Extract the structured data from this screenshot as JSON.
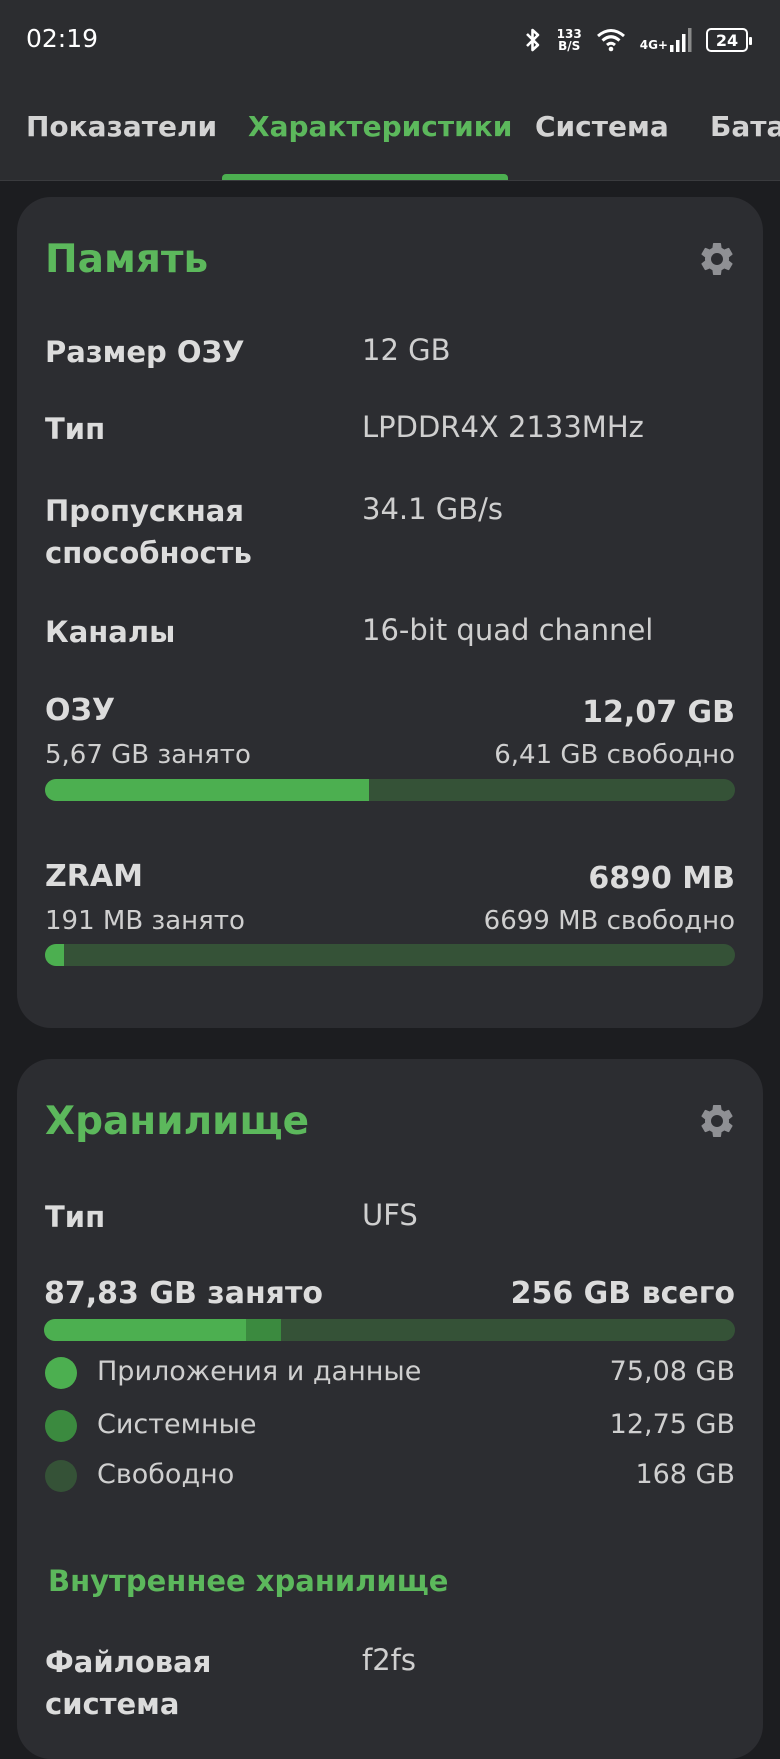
{
  "status_bar": {
    "time": "02:19",
    "speed_value": "133",
    "speed_unit": "B/S",
    "network": "4G+",
    "battery": "24",
    "icons": [
      "bluetooth-icon",
      "wifi-icon",
      "signal-icon",
      "battery-icon"
    ]
  },
  "tabs": [
    {
      "label": "Показатели"
    },
    {
      "label": "Характеристики",
      "active": true
    },
    {
      "label": "Система"
    },
    {
      "label": "Батар"
    }
  ],
  "memory": {
    "title": "Память",
    "rows": [
      {
        "label": "Размер ОЗУ",
        "value": "12 GB"
      },
      {
        "label": "Тип",
        "value": "LPDDR4X 2133MHz"
      },
      {
        "label_line1": "Пропускная",
        "label_line2": "способность",
        "value": "34.1 GB/s"
      },
      {
        "label": "Каналы",
        "value": "16-bit quad channel"
      }
    ],
    "ram": {
      "title": "ОЗУ",
      "total": "12,07 GB",
      "used": "5,67 GB занято",
      "free": "6,41 GB свободно",
      "used_fraction": 0.47
    },
    "zram": {
      "title": "ZRAM",
      "total": "6890 MB",
      "used": "191 MB занято",
      "free": "6699 MB свободно",
      "used_fraction": 0.028
    }
  },
  "storage": {
    "title": "Хранилище",
    "type_label": "Тип",
    "type_value": "UFS",
    "used": "87,83 GB занято",
    "total": "256 GB всего",
    "apps_fraction": 0.293,
    "system_fraction": 0.05,
    "legend": [
      {
        "label": "Приложения и данные",
        "value": "75,08 GB",
        "color": "#4caf50"
      },
      {
        "label": "Системные",
        "value": "12,75 GB",
        "color": "#3b8a3f"
      },
      {
        "label": "Свободно",
        "value": "168 GB",
        "color": "#355237"
      }
    ],
    "internal_title": "Внутреннее хранилище",
    "fs_label_line1": "Файловая",
    "fs_label_line2": "система",
    "fs_value": "f2fs"
  },
  "colors": {
    "accent": "#5cb85c",
    "bar_fill": "#4caf50",
    "bar_track": "#355237",
    "card_bg": "#2c2d31",
    "page_bg": "#1c1d20"
  }
}
